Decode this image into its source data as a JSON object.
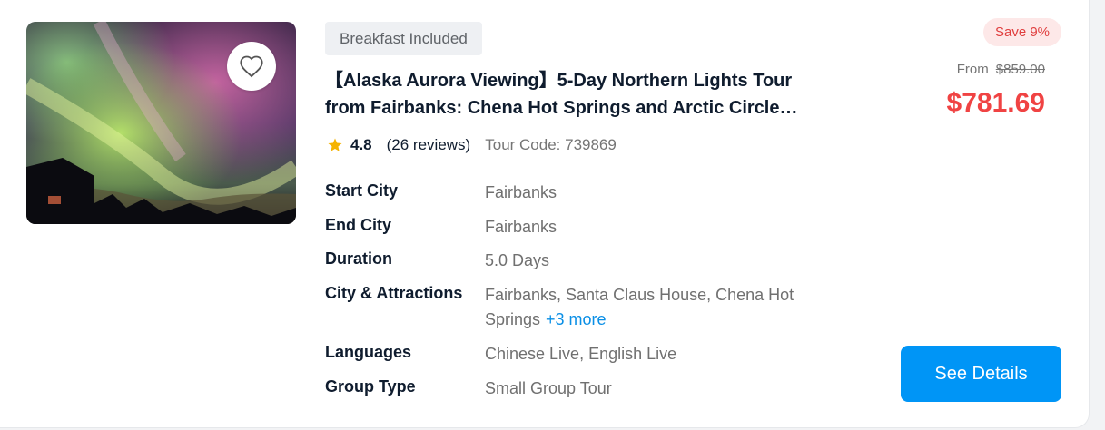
{
  "card": {
    "badge": "Breakfast Included",
    "title_line1": "【Alaska Aurora Viewing】5-Day Northern Lights Tour",
    "title_line2": "from Fairbanks: Chena Hot Springs and Arctic Circle…",
    "rating": "4.8",
    "reviews": "(26 reviews)",
    "tour_code": "Tour Code: 739869",
    "favorite_icon": "heart-outline-icon",
    "star_icon": "star-icon",
    "details": [
      {
        "label": "Start City",
        "value": "Fairbanks"
      },
      {
        "label": "End City",
        "value": "Fairbanks"
      },
      {
        "label": "Duration",
        "value": "5.0 Days"
      },
      {
        "label": "City & Attractions",
        "value": "Fairbanks, Santa Claus House, Chena Hot Springs",
        "more": "+3 more"
      },
      {
        "label": "Languages",
        "value": "Chinese Live, English Live"
      },
      {
        "label": "Group Type",
        "value": "Small Group Tour"
      }
    ],
    "save": "Save 9%",
    "from_label": "From",
    "original_price": "$859.00",
    "price": "$781.69",
    "cta": "See Details"
  },
  "colors": {
    "accent": "#0095f6",
    "price": "#f04343",
    "star": "#f5b301",
    "link": "#0a8fe6"
  }
}
